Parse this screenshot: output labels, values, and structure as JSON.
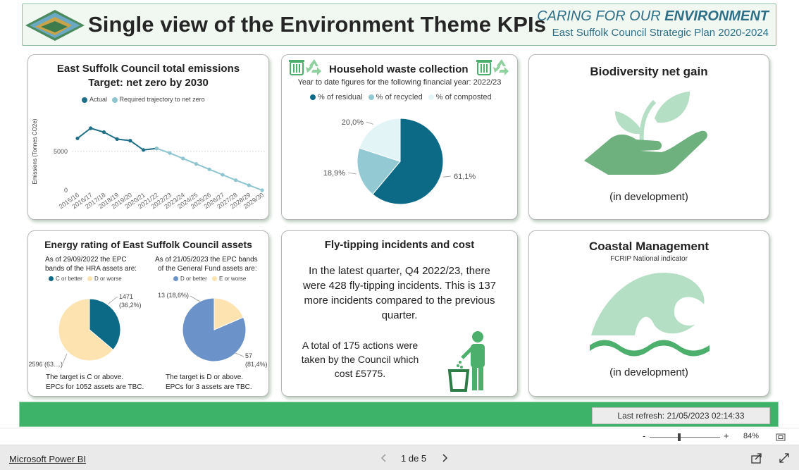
{
  "header": {
    "title": "Single view of the Environment Theme KPIs",
    "caring_prefix": "CARING FOR OUR",
    "caring_highlight": "ENVIRONMENT",
    "plan": "East Suffolk Council Strategic Plan 2020-2024"
  },
  "emissions": {
    "title_line1": "East Suffolk Council total emissions",
    "title_line2": "Target: net zero by 2030",
    "legend": [
      "Actual",
      "Required trajectory to net zero"
    ],
    "colors": {
      "actual": "#1f6f87",
      "trajectory": "#8ec5cf"
    },
    "chart_data": {
      "type": "line",
      "ylabel": "Emissions (Tonnes CO2e)",
      "yticks": [
        "5000",
        "0"
      ],
      "ylim": [
        0,
        10000
      ],
      "categories": [
        "2015/16",
        "2016/17",
        "2017/18",
        "2018/19",
        "2019/20",
        "2020/21",
        "2021/22",
        "2022/23",
        "2023/24",
        "2024/25",
        "2025/26",
        "2026/27",
        "2027/28",
        "2028/29",
        "2029/30"
      ],
      "series": [
        {
          "name": "Actual",
          "values": [
            6700,
            8000,
            7500,
            6600,
            6400,
            5200,
            5400,
            null,
            null,
            null,
            null,
            null,
            null,
            null,
            null
          ]
        },
        {
          "name": "Required trajectory to net zero",
          "values": [
            null,
            null,
            null,
            null,
            null,
            null,
            5400,
            4800,
            4100,
            3400,
            2700,
            2000,
            1300,
            650,
            0
          ]
        }
      ]
    }
  },
  "waste": {
    "title": "Household waste collection",
    "subtitle": "Year to date figures for the following financial year: 2022/23",
    "legend": [
      "% of residual",
      "% of recycled",
      "% of composted"
    ],
    "colors": [
      "#0c6a86",
      "#93c9d2",
      "#e3f4f6"
    ],
    "chart_data": {
      "type": "pie",
      "labels": [
        "% of residual",
        "% of recycled",
        "% of composted"
      ],
      "values": [
        61.1,
        18.9,
        20.0
      ],
      "data_labels": [
        "61,1%",
        "18,9%",
        "20,0%"
      ]
    }
  },
  "biodiversity": {
    "title": "Biodiversity net gain",
    "status": "(in development)"
  },
  "energy": {
    "title": "Energy rating of East Suffolk Council assets",
    "hra_text": [
      "As of 29/09/2022 the EPC",
      "bands of the HRA assets are:"
    ],
    "gf_text": [
      "As of 21/05/2023 the EPC bands",
      "of the General Fund assets are:"
    ],
    "hra_legend": [
      "C or better",
      "D or worse"
    ],
    "gf_legend": [
      "D or better",
      "E or worse"
    ],
    "hra_colors": [
      "#0c6a86",
      "#fde3b0"
    ],
    "gf_colors": [
      "#6b93c9",
      "#fde3b0"
    ],
    "hra_chart": {
      "type": "pie",
      "labels": [
        "C or better",
        "D or worse"
      ],
      "values": [
        1471,
        2596
      ],
      "data_labels": [
        "1471",
        "(36,2%)",
        "2596 (63....)"
      ]
    },
    "gf_chart": {
      "type": "pie",
      "labels": [
        "D or better",
        "E or worse"
      ],
      "values": [
        57,
        13
      ],
      "data_labels": [
        "57",
        "(81,4%)",
        "13 (18,6%)"
      ]
    },
    "hra_note": [
      "The target is C or above.",
      "EPCs for 1052 assets are TBC."
    ],
    "gf_note": [
      "The target is D or above.",
      "EPCs for 3 assets are TBC."
    ]
  },
  "flytipping": {
    "title": "Fly-tipping incidents and cost",
    "para1": [
      "In the latest quarter, Q4 2022/23, there",
      "were 428 fly-tipping incidents. This is 137",
      "more incidents compared to the previous",
      "quarter."
    ],
    "para2": [
      "A total of 175 actions were",
      "taken by the Council which",
      "cost £5775."
    ]
  },
  "coastal": {
    "title": "Coastal Management",
    "subtitle": "FCRIP National indicator",
    "status": "(in development)"
  },
  "footer": {
    "refresh": "Last refresh: 21/05/2023 02:14:33",
    "zoom_minus": "-",
    "zoom_plus": "+",
    "zoom_level": "84%",
    "brand": "Microsoft Power BI",
    "page": "1 de 5"
  }
}
